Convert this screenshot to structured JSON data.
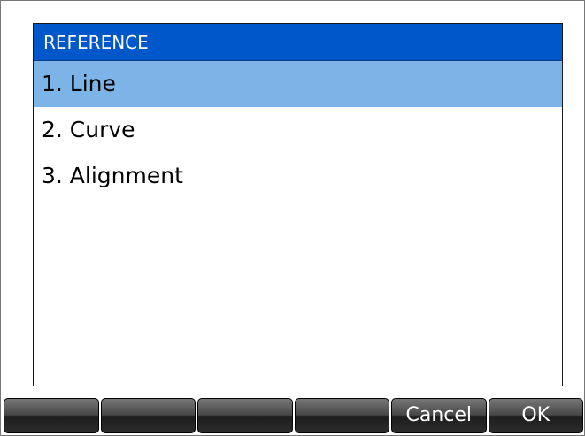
{
  "dialog": {
    "title": "REFERENCE",
    "items": [
      {
        "label": "1. Line",
        "selected": true
      },
      {
        "label": "2. Curve",
        "selected": false
      },
      {
        "label": "3. Alignment",
        "selected": false
      }
    ]
  },
  "softkeys": [
    "",
    "",
    "",
    "",
    "Cancel",
    "OK"
  ],
  "colors": {
    "title_bar": "#0057c9",
    "selection": "#7db4e8",
    "softkey_dark": "#1d1d1d"
  }
}
